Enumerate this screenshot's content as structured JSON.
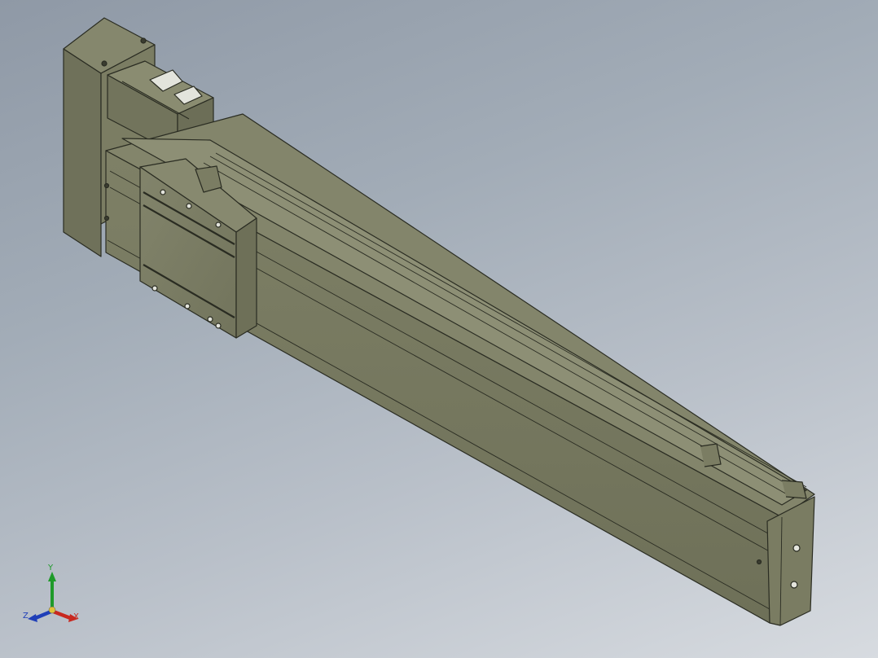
{
  "viewport": {
    "background_top": "#8f99a6",
    "background_bottom": "#d7dbe0",
    "model_color": "#76785f",
    "edge_color": "#2a2c22"
  },
  "triad": {
    "x_label": "X",
    "y_label": "Y",
    "z_label": "Z",
    "x_color": "#c8281f",
    "y_color": "#1f9a2a",
    "z_color": "#1f3fb8"
  }
}
